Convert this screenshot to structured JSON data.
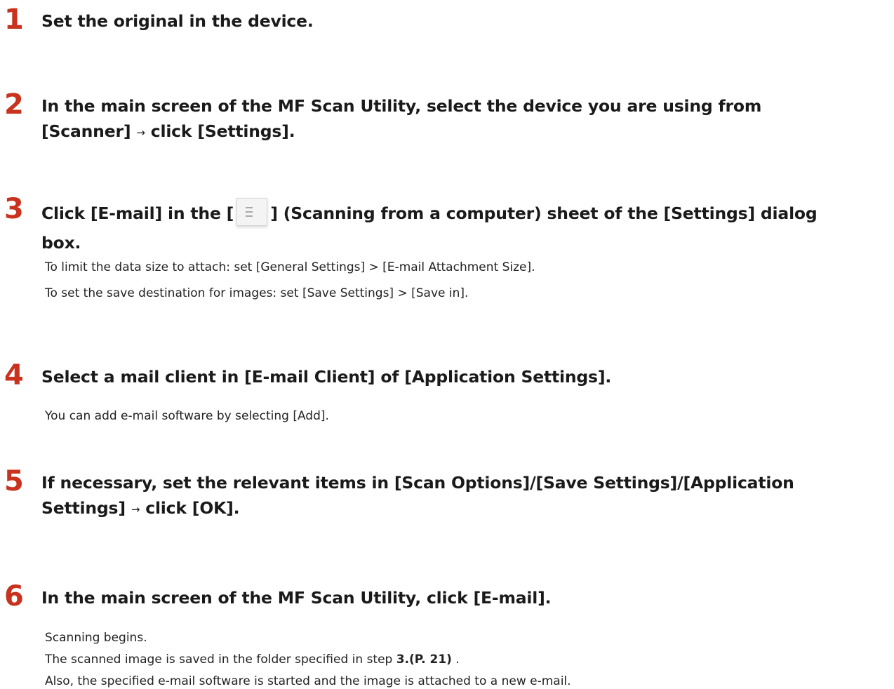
{
  "steps": [
    {
      "number": "1",
      "title": "Set the original in the device."
    },
    {
      "number": "2",
      "title_line1": "In the main screen of the MF Scan Utility, select the device you are using from",
      "title_line2_a": "[Scanner]",
      "arrow": "→",
      "title_line2_b": "click [Settings]."
    },
    {
      "number": "3",
      "title_a": "Click [E-mail] in the [",
      "title_b": "] (Scanning from a computer) sheet of the [Settings] dialog",
      "title_line2": "box.",
      "desc1": "To limit the data size to attach: set [General Settings] > [E-mail Attachment Size].",
      "desc2": "To set the save destination for images: set [Save Settings] > [Save in]."
    },
    {
      "number": "4",
      "title": "Select a mail client in [E-mail Client] of [Application Settings].",
      "desc1": "You can add e-mail software by selecting [Add]."
    },
    {
      "number": "5",
      "title_line1": "If necessary, set the relevant items in [Scan Options]/[Save Settings]/[Application",
      "title_line2_a": "Settings]",
      "arrow": "→",
      "title_line2_b": "click [OK]."
    },
    {
      "number": "6",
      "title": "In the main screen of the MF Scan Utility, click [E-mail].",
      "desc1": "Scanning begins.",
      "desc2_a": "The scanned image is saved in the folder specified in step ",
      "desc2_ref": "3.(P. 21)",
      "desc2_b": " .",
      "desc3": "Also, the specified e-mail software is started and the image is attached to a new e-mail."
    }
  ]
}
